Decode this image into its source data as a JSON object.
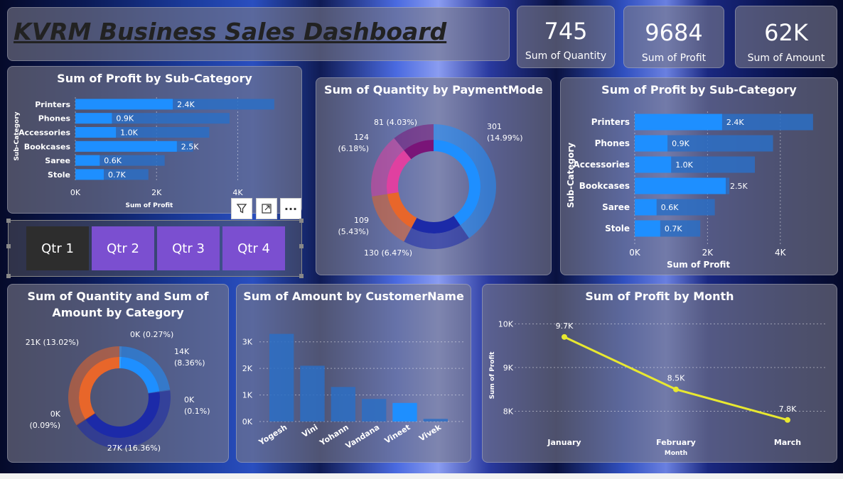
{
  "title": "KVRM Business Sales Dashboard",
  "kpis": [
    {
      "value": "745",
      "label": "Sum of Quantity"
    },
    {
      "value": "9684",
      "label": "Sum of Profit"
    },
    {
      "value": "62K",
      "label": "Sum of Amount"
    }
  ],
  "slicer": {
    "items": [
      "Qtr 1",
      "Qtr 2",
      "Qtr 3",
      "Qtr 4"
    ],
    "selected": "Qtr 1"
  },
  "toolbar": {
    "filter_icon": "filter-icon",
    "focus_icon": "focus-mode-icon",
    "more_label": "···"
  },
  "colors": {
    "bar": "#1e8fff",
    "bar_dim": "#2c6fc4",
    "line": "#e8e830",
    "accent_purple": "#7b4fd0"
  },
  "chart_data": [
    {
      "id": "profit_subcat_small",
      "type": "bar",
      "orientation": "horizontal",
      "title": "Sum of Profit by Sub-Category",
      "xlabel": "Sum of Profit",
      "ylabel": "Sub-Category",
      "categories": [
        "Printers",
        "Phones",
        "Accessories",
        "Bookcases",
        "Saree",
        "Stole"
      ],
      "values": [
        2400,
        900,
        1000,
        2500,
        600,
        700
      ],
      "value_labels": [
        "2.4K",
        "0.9K",
        "1.0K",
        "2.5K",
        "0.6K",
        "0.7K"
      ],
      "background_values": [
        4900,
        3800,
        3300,
        2900,
        2200,
        1800
      ],
      "xticks": [
        "0K",
        "2K",
        "4K"
      ],
      "xlim": [
        0,
        5200
      ]
    },
    {
      "id": "quantity_paymentmode",
      "type": "pie",
      "style": "donut",
      "title": "Sum of Quantity by PaymentMode",
      "slices": [
        {
          "label_lines": [
            "301",
            "(14.99%)"
          ],
          "value": 301,
          "color": "#1e8fff"
        },
        {
          "label_lines": [
            "130 (6.47%)"
          ],
          "value": 130,
          "color": "#1c2aa8"
        },
        {
          "label_lines": [
            "109",
            "(5.43%)"
          ],
          "value": 109,
          "color": "#e8662a"
        },
        {
          "label_lines": [
            "124",
            "(6.18%)"
          ],
          "value": 124,
          "color": "#e040a0"
        },
        {
          "label_lines": [
            "81 (4.03%)"
          ],
          "value": 81,
          "color": "#7a1478"
        }
      ]
    },
    {
      "id": "profit_subcat_large",
      "type": "bar",
      "orientation": "horizontal",
      "title": "Sum of Profit by Sub-Category",
      "xlabel": "Sum of Profit",
      "ylabel": "Sub-Category",
      "categories": [
        "Printers",
        "Phones",
        "Accessories",
        "Bookcases",
        "Saree",
        "Stole"
      ],
      "values": [
        2400,
        900,
        1000,
        2500,
        600,
        700
      ],
      "value_labels": [
        "2.4K",
        "0.9K",
        "1.0K",
        "2.5K",
        "0.6K",
        "0.7K"
      ],
      "background_values": [
        4900,
        3800,
        3300,
        2600,
        2200,
        1800
      ],
      "xticks": [
        "0K",
        "2K",
        "4K"
      ],
      "xlim": [
        0,
        5000
      ]
    },
    {
      "id": "qty_amount_category",
      "type": "pie",
      "style": "donut",
      "title": "Sum of Quantity and Sum of Amount by Category",
      "slices": [
        {
          "label_lines": [
            "0K (0.27%)"
          ],
          "value": 0.27,
          "color": "#3aa0ff"
        },
        {
          "label_lines": [
            "14K",
            "(8.36%)"
          ],
          "value": 8.36,
          "color": "#1e8fff"
        },
        {
          "label_lines": [
            "0K",
            "(0.1%)"
          ],
          "value": 0.1,
          "color": "#2a60c0"
        },
        {
          "label_lines": [
            "27K (16.36%)"
          ],
          "value": 16.36,
          "color": "#1c2aa8"
        },
        {
          "label_lines": [
            "0K",
            "(0.09%)"
          ],
          "value": 0.09,
          "color": "#a04020"
        },
        {
          "label_lines": [
            "21K (13.02%)"
          ],
          "value": 13.02,
          "color": "#e8662a"
        }
      ]
    },
    {
      "id": "amount_customer",
      "type": "bar",
      "orientation": "vertical",
      "title": "Sum of Amount by CustomerName",
      "categories": [
        "Yogesh",
        "Vini",
        "Yohann",
        "Vandana",
        "Vineet",
        "Vivek"
      ],
      "values": [
        3300,
        2100,
        1300,
        850,
        700,
        100
      ],
      "yticks": [
        "0K",
        "1K",
        "2K",
        "3K"
      ],
      "ylim": [
        0,
        3500
      ]
    },
    {
      "id": "profit_month",
      "type": "line",
      "title": "Sum of Profit by Month",
      "xlabel": "Month",
      "ylabel": "Sum of Profit",
      "x": [
        "January",
        "February",
        "March"
      ],
      "y": [
        9700,
        8500,
        7800
      ],
      "value_labels": [
        "9.7K",
        "8.5K",
        "7.8K"
      ],
      "yticks": [
        "8K",
        "9K",
        "10K"
      ],
      "ylim": [
        7650,
        10250
      ]
    }
  ]
}
